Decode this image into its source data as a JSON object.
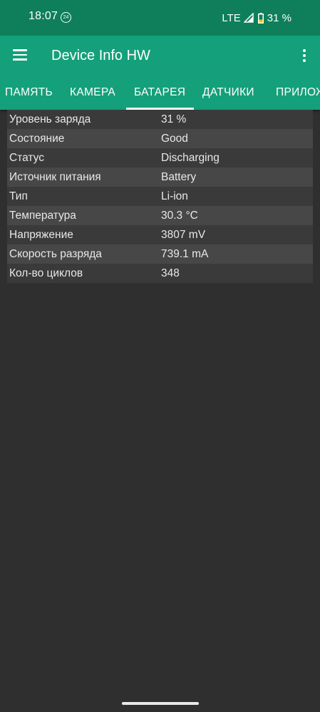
{
  "status_bar": {
    "time": "18:07",
    "clock_badge": "24",
    "network": "LTE",
    "battery_percent": "31 %"
  },
  "app_bar": {
    "title": "Device Info HW",
    "menu_icon": "menu-icon",
    "overflow_icon": "more-vert-icon"
  },
  "tabs": [
    {
      "label": "ПАМЯТЬ",
      "selected": false
    },
    {
      "label": "КАМЕРА",
      "selected": false
    },
    {
      "label": "БАТАРЕЯ",
      "selected": true
    },
    {
      "label": "ДАТЧИКИ",
      "selected": false
    },
    {
      "label": "ПРИЛОЖЕНИЯ",
      "selected": false
    }
  ],
  "battery_info": [
    {
      "label": "Уровень заряда",
      "value": "31 %"
    },
    {
      "label": "Состояние",
      "value": "Good"
    },
    {
      "label": "Статус",
      "value": "Discharging"
    },
    {
      "label": "Источник питания",
      "value": "Battery"
    },
    {
      "label": "Тип",
      "value": "Li-ion"
    },
    {
      "label": "Температура",
      "value": "30.3 °C"
    },
    {
      "label": "Напряжение",
      "value": "3807 mV"
    },
    {
      "label": "Скорость разряда",
      "value": "739.1 mA"
    },
    {
      "label": "Кол-во циклов",
      "value": "348"
    }
  ],
  "colors": {
    "status_bar_bg": "#0e7f5a",
    "app_bar_bg": "#14a07a",
    "page_bg": "#2f2f2f",
    "row_odd": "#3a3a3a",
    "row_even": "#474747",
    "battery_fill": "#f2c200"
  }
}
